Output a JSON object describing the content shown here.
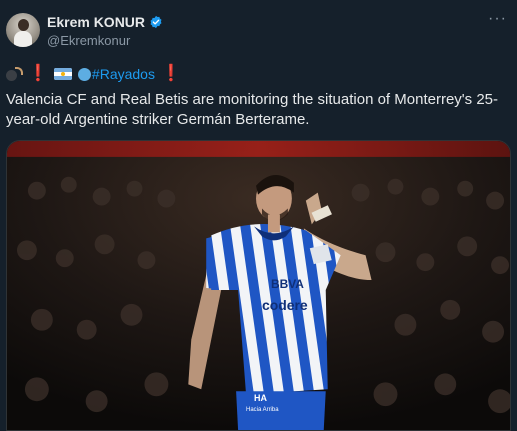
{
  "tweet": {
    "author": {
      "display_name": "Ekrem KONUR",
      "handle": "@Ekremkonur"
    },
    "more_label": "···",
    "prefix": {
      "exclamation_1": "❗",
      "exclamation_2": "❗",
      "hashtag": "#Rayados"
    },
    "text": "Valencia CF and Real Betis are monitoring the situation of Monterrey's 25-year-old Argentine striker Germán Berterame.",
    "media": {
      "jersey_sponsor_top": "BBVA",
      "jersey_sponsor_bottom": "codere",
      "shorts_text": "HA",
      "shorts_subtext": "Hacia Arriba"
    }
  },
  "colors": {
    "background": "#15202b",
    "accent": "#1d9bf0",
    "verified": "#1d9bf0",
    "text": "#e7e9ea",
    "muted": "#8b98a5",
    "jersey_blue": "#1f56c4"
  },
  "icons": {
    "verified": "verified-badge-icon",
    "more": "more-horizontal-icon",
    "bomb": "bomb-emoji",
    "flag": "argentina-flag-emoji",
    "circle": "blue-circle-emoji"
  }
}
